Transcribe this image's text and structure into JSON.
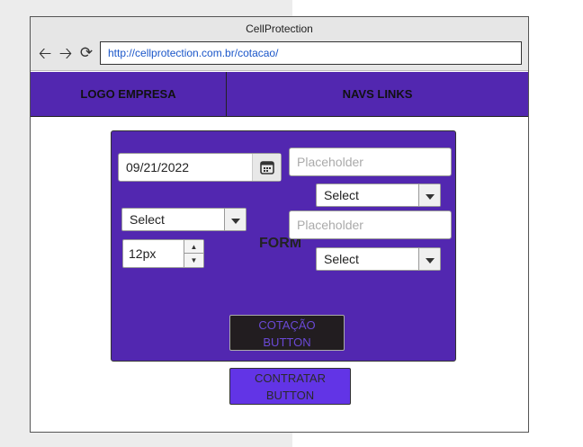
{
  "browser": {
    "title": "CellProtection",
    "url": "http://cellprotection.com.br/cotacao/",
    "back_icon": "arrow-left-icon",
    "forward_icon": "arrow-right-icon",
    "reload_icon": "reload-icon"
  },
  "header": {
    "logo_label": "LOGO EMPRESA",
    "nav_label": "NAVS LINKS",
    "background": "#5227b0"
  },
  "form": {
    "label": "FORM",
    "date_value": "09/21/2022",
    "date_icon": "calendar-icon",
    "placeholder_1": "Placeholder",
    "placeholder_2": "Placeholder",
    "select_right_1": "Select",
    "select_left": "Select",
    "select_right_2": "Select",
    "stepper_value": "12px",
    "cotacao_button": "COTAÇÃO\nBUTTON"
  },
  "contratar_button": "CONTRATAR\nBUTTON",
  "colors": {
    "accent": "#5227b0",
    "cotacao_bg": "#221d20",
    "cotacao_text": "#6a49d6",
    "contratar_bg": "#6234e6"
  }
}
